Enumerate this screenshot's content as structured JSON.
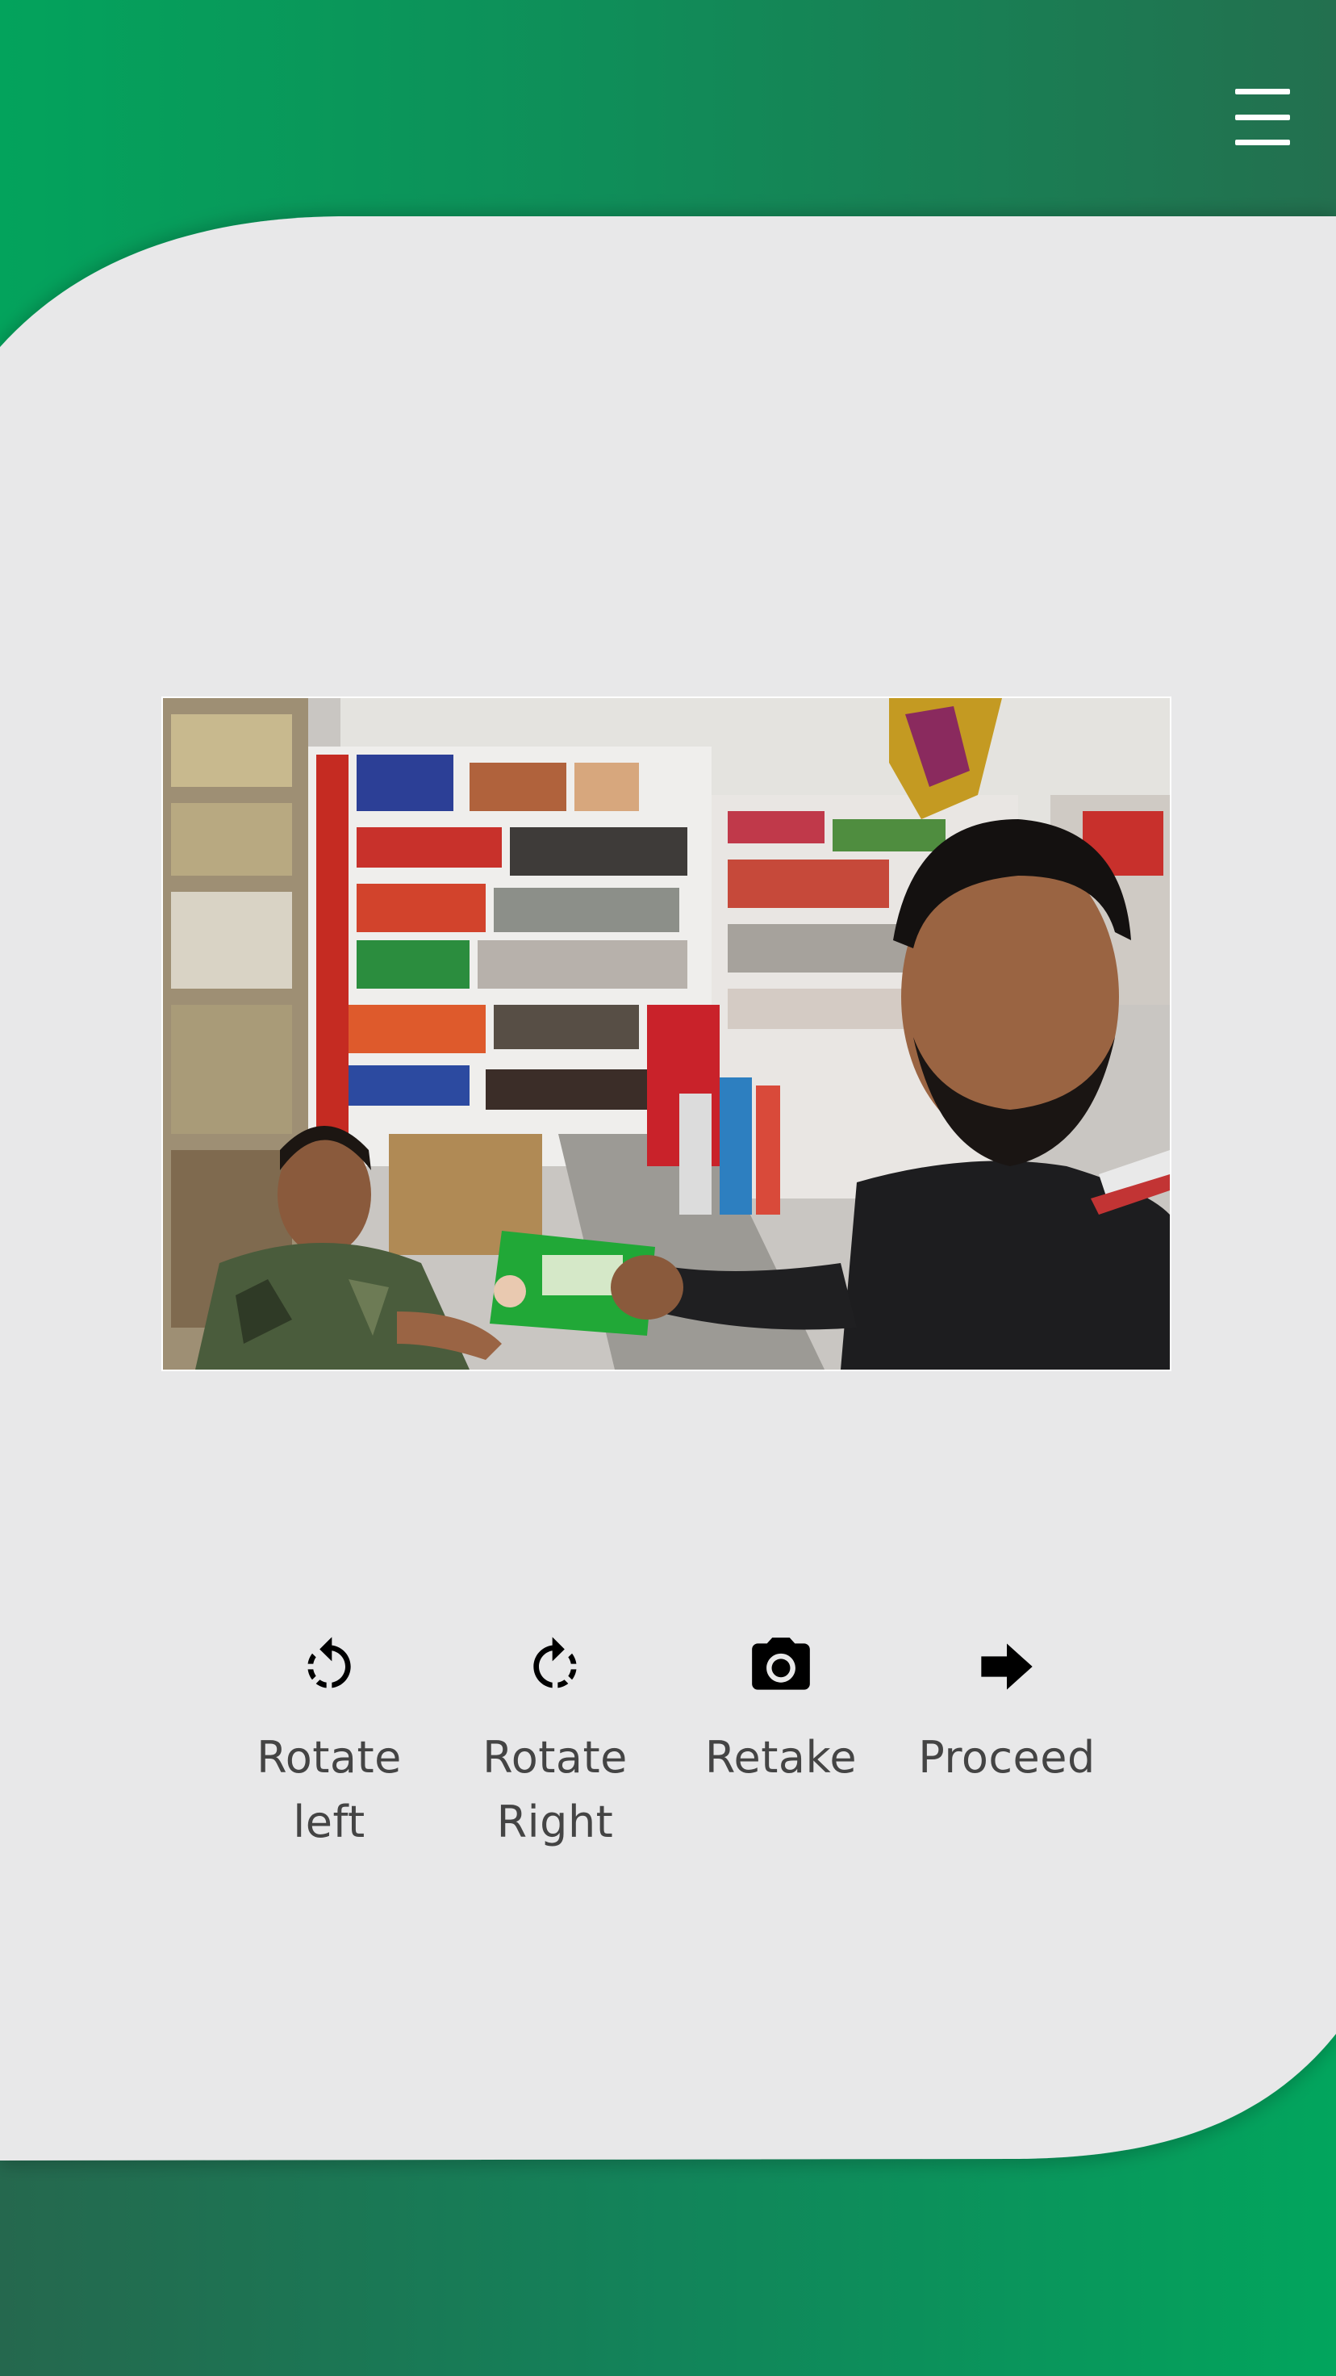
{
  "header": {
    "menu_icon": "hamburger-menu-icon"
  },
  "photo": {
    "alt": "Shop photo preview"
  },
  "actions": [
    {
      "icon": "rotate-left-icon",
      "label_line1": "Rotate",
      "label_line2": "left"
    },
    {
      "icon": "rotate-right-icon",
      "label_line1": "Rotate",
      "label_line2": "Right"
    },
    {
      "icon": "camera-icon",
      "label_line1": "Retake",
      "label_line2": ""
    },
    {
      "icon": "arrow-right-icon",
      "label_line1": "Proceed",
      "label_line2": ""
    }
  ],
  "colors": {
    "brand_green": "#03a35c",
    "brand_dark_green": "#23704f",
    "background": "#e8e8e9",
    "label_text": "#444444"
  }
}
